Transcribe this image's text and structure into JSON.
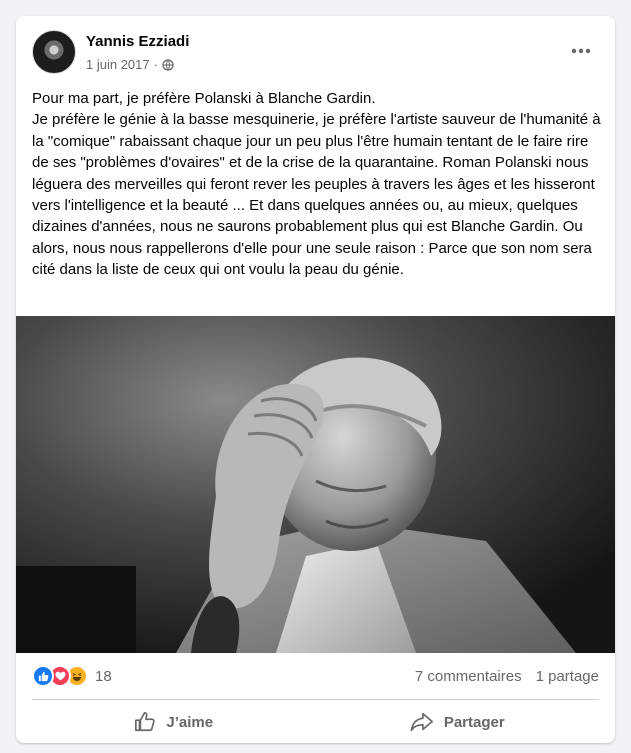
{
  "post": {
    "author": "Yannis Ezziadi",
    "date": "1 juin 2017",
    "separator": "·",
    "paragraphs": [
      "Pour ma part, je préfère Polanski à Blanche Gardin.",
      "Je préfère le génie à la basse mesquinerie, je préfère l'artiste sauveur de l'humanité à la \"comique\" rabaissant chaque jour un peu plus l'être humain tentant de le faire rire de ses \"problèmes d'ovaires\" et de la crise de la quarantaine. Roman Polanski nous léguera des merveilles qui feront rever les peuples à travers les âges et les hisseront vers l'intelligence et la beauté ... Et dans quelques années ou, au mieux, quelques dizaines d'années, nous ne saurons probablement plus qui est Blanche Gardin. Ou alors, nous nous rappellerons d'elle pour une seule raison : Parce que son nom sera cité dans la liste de ceux qui ont voulu la peau du génie."
    ]
  },
  "stats": {
    "reaction_count": "18",
    "comments": "7 commentaires",
    "shares": "1 partage"
  },
  "actions": {
    "like_label": "J’aime",
    "share_label": "Partager"
  },
  "icons": {
    "more": "more-dots-icon",
    "privacy": "globe-icon",
    "reactions": [
      "like-icon",
      "love-icon",
      "haha-icon"
    ],
    "like": "thumbs-up-icon",
    "share": "share-arrow-icon"
  },
  "colors": {
    "background": "#f0f2f5",
    "card": "#ffffff",
    "secondary_text": "#65676b",
    "like_blue": "#1877f2",
    "love_red": "#f33e58",
    "haha_yellow": "#f7b125"
  }
}
